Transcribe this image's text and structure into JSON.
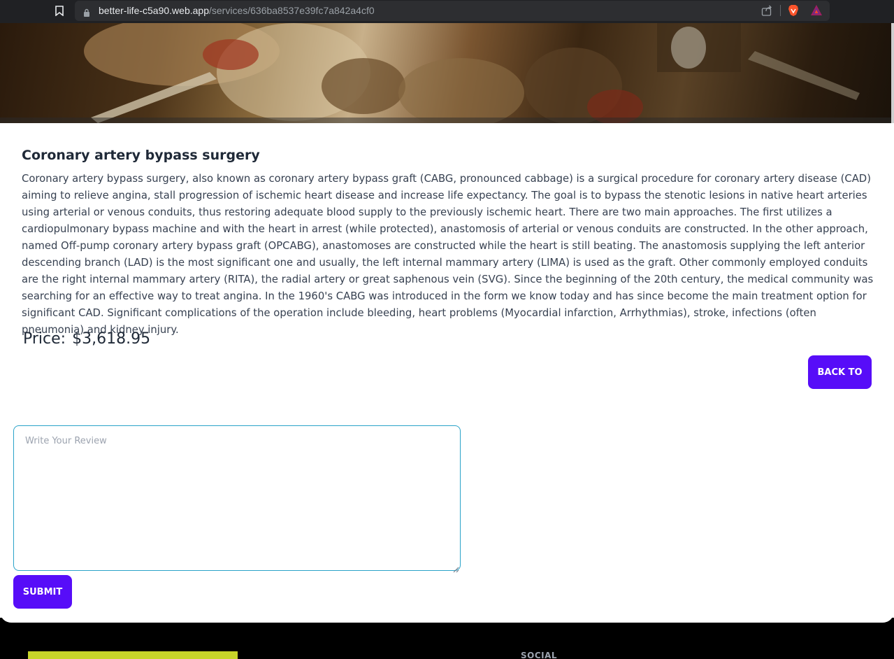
{
  "browser": {
    "url_domain": "better-life-c5a90.web.app",
    "url_path": "/services/636ba8537e39fc7a842a4cf0"
  },
  "service": {
    "title": "Coronary artery bypass surgery",
    "description": "Coronary artery bypass surgery, also known as coronary artery bypass graft (CABG, pronounced cabbage) is a surgical procedure for coronary artery disease (CAD) aiming to relieve angina, stall progression of ischemic heart disease and increase life expectancy. The goal is to bypass the stenotic lesions in native heart arteries using arterial or venous conduits, thus restoring adequate blood supply to the previously ischemic heart. There are two main approaches. The first utilizes a cardiopulmonary bypass machine and with the heart in arrest (while protected), anastomosis of arterial or venous conduits are constructed. In the other approach, named Off-pump coronary artery bypass graft (OPCABG), anastomoses are constructed while the heart is still beating. The anastomosis supplying the left anterior descending branch (LAD) is the most significant one and usually, the left internal mammary artery (LIMA) is used as the graft. Other commonly employed conduits are the right internal mammary artery (RITA), the radial artery or great saphenous vein (SVG). Since the beginning of the 20th century, the medical community was searching for an effective way to treat angina. In the 1960's CABG was introduced in the form we know today and has since become the main treatment option for significant CAD. Significant complications of the operation include bleeding, heart problems (Myocardial infarction, Arrhythmias), stroke, infections (often pneumonia) and kidney injury.",
    "price_label": "Price:",
    "price_value": "$3,618.95",
    "back_label": "BACK TO"
  },
  "review": {
    "placeholder": "Write Your Review",
    "value": "",
    "submit_label": "SUBMIT"
  },
  "footer": {
    "social_heading": "SOCIAL"
  },
  "colors": {
    "primary": "#570df8",
    "textarea_border": "#2aa3c9",
    "footer_bg": "#000000",
    "footer_logo": "#c7d42a"
  },
  "icons": [
    "bookmark-icon",
    "lock-icon",
    "share-icon",
    "brave-shield-icon",
    "brave-rewards-icon"
  ]
}
